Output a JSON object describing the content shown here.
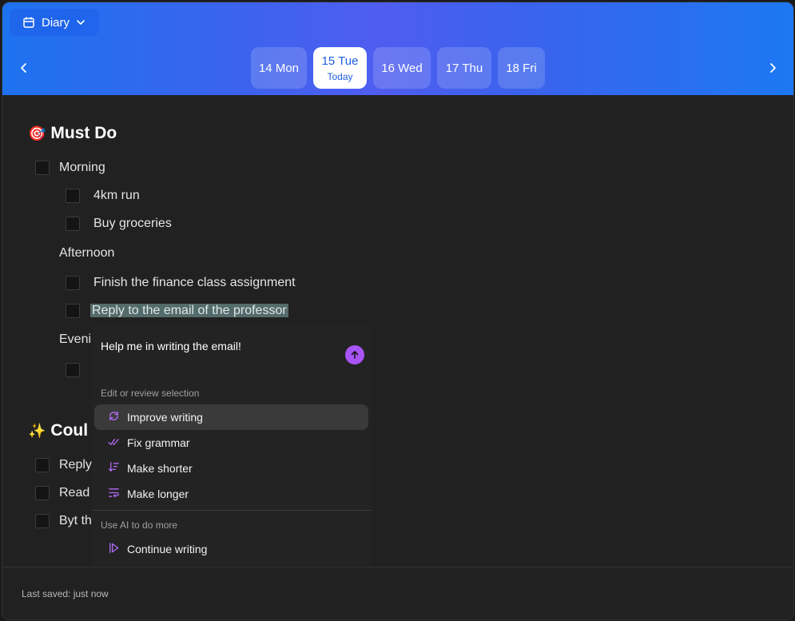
{
  "header": {
    "view_selector": {
      "label": "Diary",
      "icon": "calendar-icon"
    },
    "days": [
      {
        "label": "14 Mon",
        "active": false
      },
      {
        "label": "15 Tue",
        "sub": "Today",
        "active": true
      },
      {
        "label": "16 Wed",
        "active": false
      },
      {
        "label": "17 Thu",
        "active": false
      },
      {
        "label": "18 Fri",
        "active": false
      }
    ],
    "accent": "#1f5fe0"
  },
  "must_do": {
    "emoji": "🎯",
    "title": "Must Do",
    "morning_label": "Morning",
    "morning_tasks": [
      "4km run",
      "Buy groceries"
    ],
    "afternoon_label": "Afternoon",
    "afternoon_tasks": [
      "Finish the finance class assignment",
      "Reply to the email of the professor"
    ],
    "evening_label_partial": "Eveni"
  },
  "could_do": {
    "emoji": "✨",
    "title_partial": "Coul",
    "tasks_partial": [
      "Reply",
      "Read",
      "Byt th"
    ]
  },
  "ai_popup": {
    "prompt": "Help me in writing the email!",
    "send_color": "#a855f7",
    "edit_heading": "Edit or review selection",
    "edit_items": [
      {
        "label": "Improve writing",
        "icon": "refresh-sparkle-icon"
      },
      {
        "label": "Fix grammar",
        "icon": "double-check-icon"
      },
      {
        "label": "Make shorter",
        "icon": "sort-shorter-icon"
      },
      {
        "label": "Make longer",
        "icon": "text-wrap-longer-icon"
      }
    ],
    "more_heading": "Use AI to do more",
    "more_items": [
      {
        "label": "Continue writing",
        "icon": "play-continue-icon"
      }
    ]
  },
  "footer": {
    "status": "Last saved: just now"
  }
}
